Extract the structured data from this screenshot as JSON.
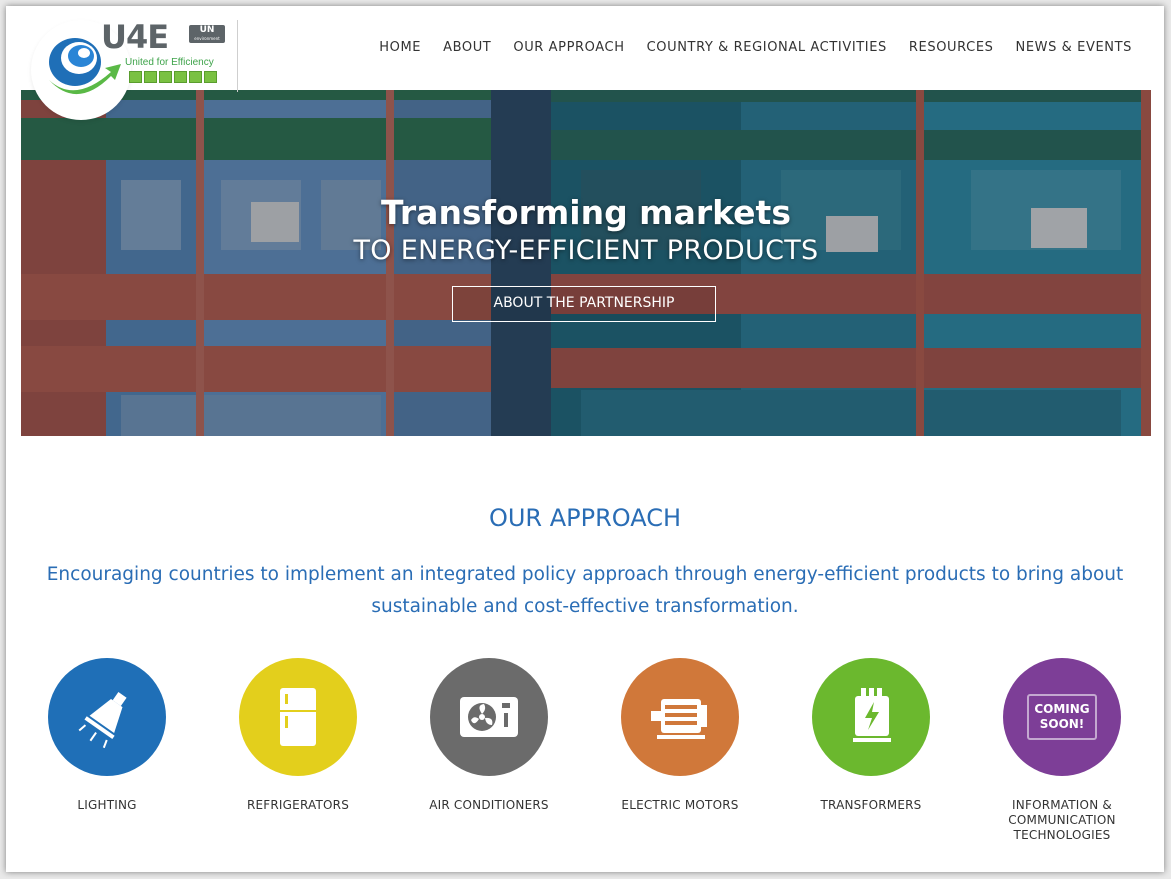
{
  "brand": {
    "name": "U4E",
    "un_badge": "UN",
    "un_sub": "environment",
    "tagline": "United for Efficiency"
  },
  "nav": {
    "items": [
      {
        "label": "HOME"
      },
      {
        "label": "ABOUT"
      },
      {
        "label": "OUR APPROACH"
      },
      {
        "label": "COUNTRY & REGIONAL ACTIVITIES"
      },
      {
        "label": "RESOURCES"
      },
      {
        "label": "NEWS & EVENTS"
      }
    ]
  },
  "hero": {
    "title": "Transforming markets",
    "subtitle": "TO ENERGY-EFFICIENT PRODUCTS",
    "button": "ABOUT THE PARTNERSHIP"
  },
  "approach": {
    "title": "OUR APPROACH",
    "text": "Encouraging countries to implement an integrated policy approach through energy-efficient products to bring about sustainable and cost-effective transformation."
  },
  "products": [
    {
      "label": "LIGHTING",
      "icon": "lamp-icon",
      "color": "#1f6fb7"
    },
    {
      "label": "REFRIGERATORS",
      "icon": "refrigerator-icon",
      "color": "#e3cf1c"
    },
    {
      "label": "AIR CONDITIONERS",
      "icon": "air-conditioner-icon",
      "color": "#6b6b6b"
    },
    {
      "label": "ELECTRIC MOTORS",
      "icon": "motor-icon",
      "color": "#d0783a"
    },
    {
      "label": "TRANSFORMERS",
      "icon": "transformer-icon",
      "color": "#6bb82e"
    },
    {
      "label": "INFORMATION & COMMUNICATION TECHNOLOGIES",
      "icon": "laptop-icon",
      "color": "#7d3e97",
      "badge": "COMING SOON!"
    }
  ]
}
